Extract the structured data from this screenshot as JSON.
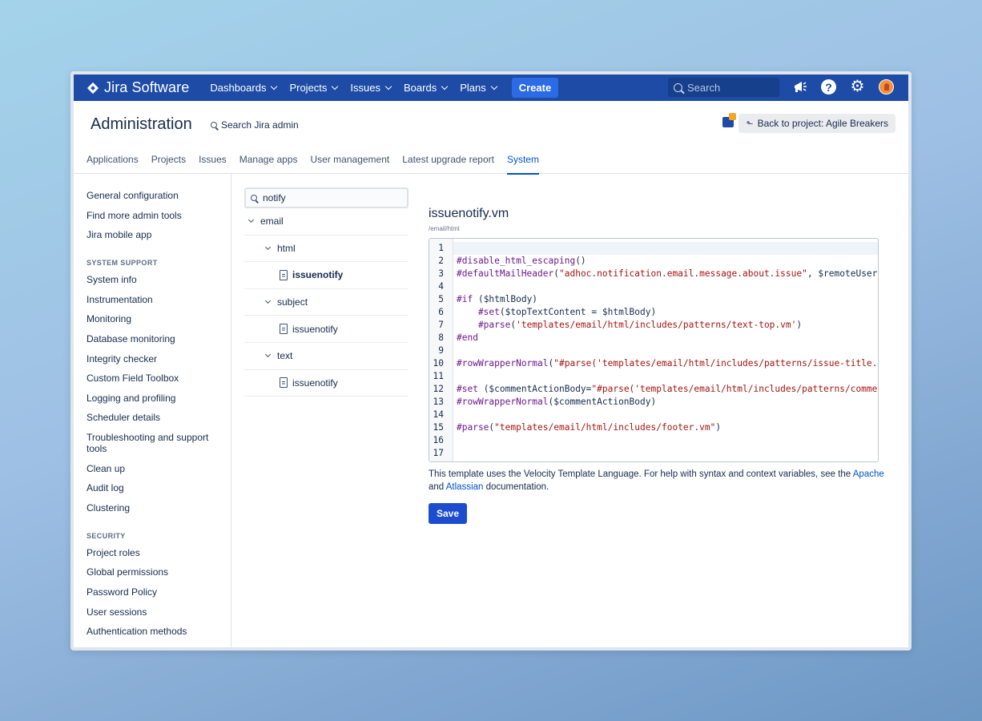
{
  "topnav": {
    "brand": "Jira Software",
    "items": [
      "Dashboards",
      "Projects",
      "Issues",
      "Boards",
      "Plans"
    ],
    "create": "Create",
    "search_placeholder": "Search",
    "icons": [
      "megaphone-icon",
      "help-icon",
      "gear-icon",
      "avatar"
    ]
  },
  "header": {
    "title": "Administration",
    "search": "Search Jira admin",
    "back": "Back to project: Agile Breakers"
  },
  "tabs": [
    "Applications",
    "Projects",
    "Issues",
    "Manage apps",
    "User management",
    "Latest upgrade report",
    "System"
  ],
  "active_tab": "System",
  "sidebar": {
    "top": [
      "General configuration",
      "Find more admin tools",
      "Jira mobile app"
    ],
    "system_support_heading": "SYSTEM SUPPORT",
    "system_support": [
      "System info",
      "Instrumentation",
      "Monitoring",
      "Database monitoring",
      "Integrity checker",
      "Custom Field Toolbox",
      "Logging and profiling",
      "Scheduler details",
      "Troubleshooting and support tools",
      "Clean up",
      "Audit log",
      "Clustering"
    ],
    "security_heading": "SECURITY",
    "security": [
      "Project roles",
      "Global permissions",
      "Password Policy",
      "User sessions",
      "Authentication methods"
    ]
  },
  "tree": {
    "search_value": "notify",
    "root": "email",
    "groups": [
      {
        "name": "html",
        "file": "issuenotify"
      },
      {
        "name": "subject",
        "file": "issuenotify"
      },
      {
        "name": "text",
        "file": "issuenotify"
      }
    ]
  },
  "editor": {
    "title": "issuenotify.vm",
    "path": "/email/html",
    "line_numbers": [
      "1",
      "2",
      "3",
      "4",
      "5",
      "6",
      "7",
      "8",
      "9",
      "10",
      "11",
      "12",
      "13",
      "14",
      "15",
      "16",
      "17"
    ],
    "lines": [
      {
        "a": "",
        "b": "",
        "c": ""
      },
      {
        "a": "#disable_html_escaping",
        "b": "()",
        "c": ""
      },
      {
        "a": "#defaultMailHeader",
        "b": "(",
        "c": "\"adhoc.notification.email.message.about.issue\"",
        "d": ", $remoteUser"
      },
      {
        "a": "",
        "b": "",
        "c": ""
      },
      {
        "a": "#if",
        "b": " ($htmlBody)",
        "c": ""
      },
      {
        "a": "    #set",
        "b": "($topTextContent = $htmlBody)",
        "c": ""
      },
      {
        "a": "    #parse",
        "b": "(",
        "c": "'templates/email/html/includes/patterns/text-top.vm'",
        "d": ")"
      },
      {
        "a": "#end",
        "b": "",
        "c": ""
      },
      {
        "a": "",
        "b": "",
        "c": ""
      },
      {
        "a": "#rowWrapperNormal",
        "b": "(",
        "c": "\"#parse('templates/email/html/includes/patterns/issue-title.vm')\""
      },
      {
        "a": "",
        "b": "",
        "c": ""
      },
      {
        "a": "#set",
        "b": " ($commentActionBody=",
        "c": "\"#parse('templates/email/html/includes/patterns/comment-action.vm')\""
      },
      {
        "a": "#rowWrapperNormal",
        "b": "($commentActionBody)",
        "c": ""
      },
      {
        "a": "",
        "b": "",
        "c": ""
      },
      {
        "a": "#parse",
        "b": "(",
        "c": "\"templates/email/html/includes/footer.vm\"",
        "d": ")"
      },
      {
        "a": "",
        "b": "",
        "c": ""
      },
      {
        "a": "",
        "b": "",
        "c": ""
      }
    ],
    "help_before": "This template uses the Velocity Template Language. For help with syntax and context variables, see the ",
    "help_link1": "Apache",
    "help_mid": " and ",
    "help_link2": "Atlassian",
    "help_after": " documentation.",
    "save": "Save"
  }
}
